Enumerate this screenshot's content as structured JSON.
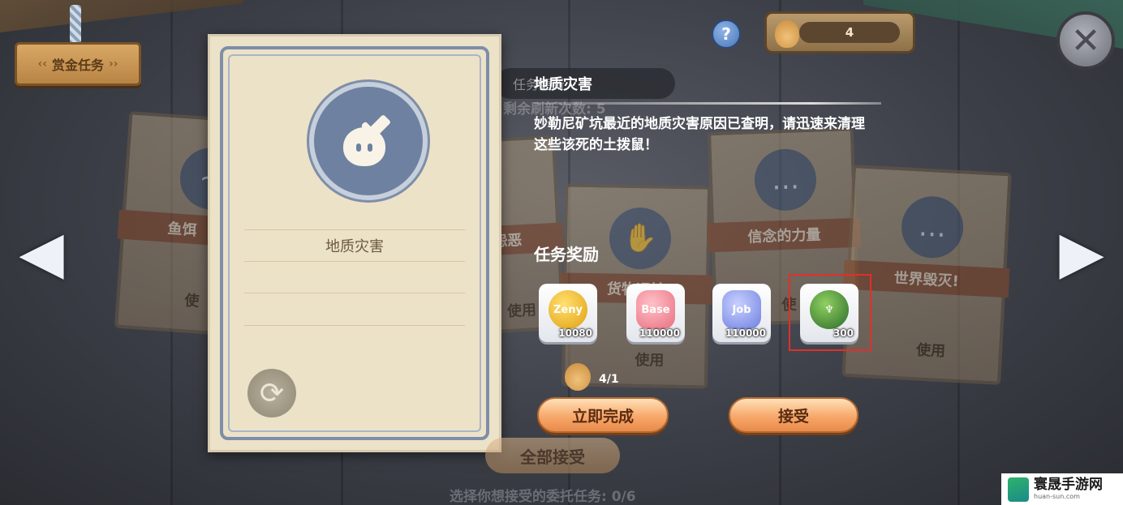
{
  "header": {
    "bounty_label": "赏金任务",
    "help_label": "?",
    "counter_value": "4",
    "close_label": "✕"
  },
  "nav": {
    "left_arrow": "◀",
    "right_arrow": "▶"
  },
  "refresh": {
    "label": "任务更新",
    "remaining": "剩余刷新次数: 5"
  },
  "background_cards": [
    {
      "title": "鱼饵",
      "use": "使"
    },
    {
      "title": "怨恶",
      "use": "使用"
    },
    {
      "title": "货物运输",
      "use": "使用"
    },
    {
      "title": "信念的力量",
      "use": "使"
    },
    {
      "title": "世界毁灭!",
      "use": "使用"
    }
  ],
  "main_card": {
    "title": "地质灾害"
  },
  "detail": {
    "task_name": "地质灾害",
    "description": "妙勒尼矿坑最近的地质灾害原因已查明，请迅速来清理这些该死的土拨鼠！",
    "reward_title": "任务奖励",
    "rewards": [
      {
        "icon": "zeny-coin-icon",
        "label": "Zeny",
        "qty": "10080",
        "color": "#f0b020"
      },
      {
        "icon": "base-exp-icon",
        "label": "Base",
        "qty": "110000",
        "color": "#f08a9a"
      },
      {
        "icon": "job-exp-icon",
        "label": "Job",
        "qty": "110000",
        "color": "#8a9ae8"
      },
      {
        "icon": "green-crest-icon",
        "label": "",
        "qty": "300",
        "color": "#3a8a3a"
      }
    ],
    "progress": "4/1"
  },
  "buttons": {
    "complete_now": "立即完成",
    "accept": "接受",
    "accept_all": "全部接受"
  },
  "footer": {
    "select_text": "选择你想接受的委托任务: 0/6"
  },
  "watermark": {
    "name": "寰晟手游网",
    "url": "huan-sun.com"
  }
}
